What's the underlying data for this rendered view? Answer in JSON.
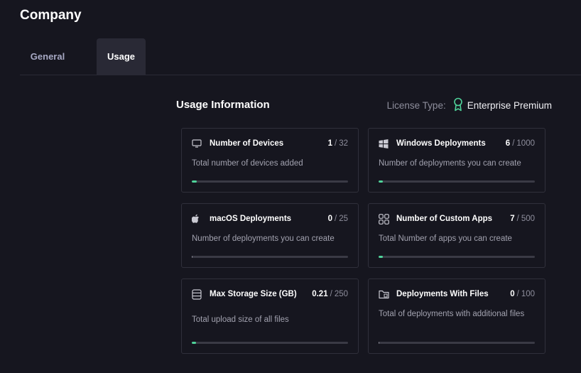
{
  "page": {
    "title": "Company"
  },
  "tabs": [
    {
      "label": "General",
      "active": false
    },
    {
      "label": "Usage",
      "active": true
    }
  ],
  "usage": {
    "title": "Usage Information",
    "license_label": "License Type:",
    "license_value": "Enterprise Premium"
  },
  "colors": {
    "accent": "#4fd39a",
    "background": "#16161f",
    "tab_active": "#292935"
  },
  "cards": [
    {
      "icon": "monitor-icon",
      "title": "Number of Devices",
      "used": "1",
      "total": "32",
      "description": "Total number of devices added",
      "progress": 0.03125
    },
    {
      "icon": "windows-icon",
      "title": "Windows Deployments",
      "used": "6",
      "total": "1000",
      "description": "Number of deployments you can create",
      "progress": 0.006
    },
    {
      "icon": "apple-icon",
      "title": "macOS Deployments",
      "used": "0",
      "total": "25",
      "description": "Number of deployments you can create",
      "progress": 0
    },
    {
      "icon": "apps-grid-icon",
      "title": "Number of Custom Apps",
      "used": "7",
      "total": "500",
      "description": "Total Number of apps you can create",
      "progress": 0.014
    },
    {
      "icon": "database-icon",
      "title": "Max Storage Size (GB)",
      "used": "0.21",
      "total": "250",
      "description": "Total upload size of all files",
      "progress": 0.00084
    },
    {
      "icon": "folder-file-icon",
      "title": "Deployments With Files",
      "used": "0",
      "total": "100",
      "description": "Total of deployments with additional files",
      "progress": 0
    }
  ]
}
